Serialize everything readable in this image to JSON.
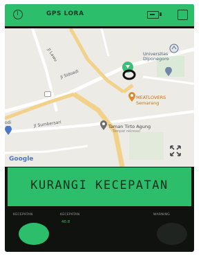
{
  "app": {
    "title": "GPS LORA",
    "icons": [
      "back-icon",
      "battery-icon",
      "square-icon"
    ]
  },
  "map": {
    "labels": {
      "street1": "Jl Lawu",
      "street2": "Jl Sidoadi",
      "street3": "Jl Sumbersari",
      "university": "Universitas Diponegoro",
      "restaurant": "MEATLOVERS Semarang",
      "park": "Taman Tirto Agung",
      "park_sub": "Tempat rekreasi",
      "left_edge": "odi"
    },
    "google_logo": "Google",
    "restaurant_icon": "restaurant-pin-icon",
    "park_icon": "place-pin-icon",
    "location_icon": "current-location-icon",
    "expand_icon": "fullscreen-icon"
  },
  "banner": {
    "text": "KURANGI KECEPATAN"
  },
  "bottom": {
    "speed_label_left": "KECEPATAN",
    "speed_label_center": "KECEPATAN",
    "speed_value": "40.8",
    "warning_label": "WARNING"
  },
  "colors": {
    "accent": "#2dbe6c",
    "background": "#101210",
    "indicator_off": "#1f2420"
  }
}
